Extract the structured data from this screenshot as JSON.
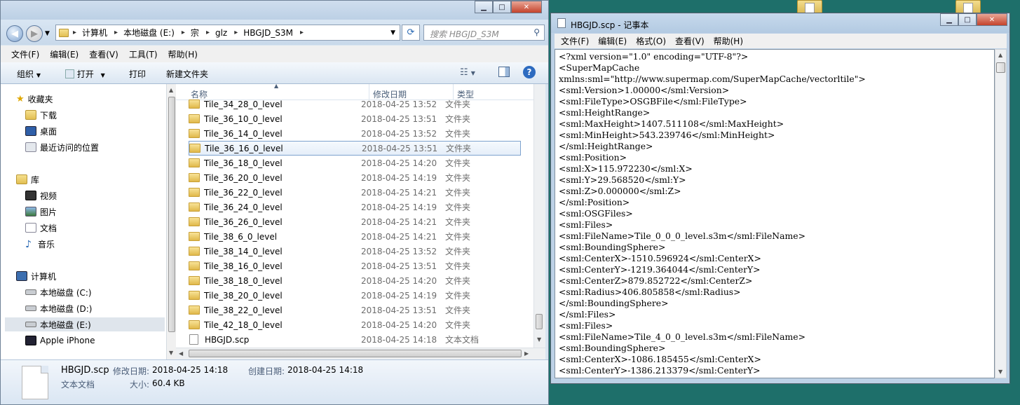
{
  "explorer": {
    "address": {
      "crumbs": [
        "计算机",
        "本地磁盘 (E:)",
        "宗",
        "glz",
        "HBGJD_S3M"
      ]
    },
    "search": {
      "placeholder": "搜索 HBGJD_S3M"
    },
    "menu": [
      "文件(F)",
      "编辑(E)",
      "查看(V)",
      "工具(T)",
      "帮助(H)"
    ],
    "toolbar": {
      "organize": "组织",
      "open": "打开",
      "print": "打印",
      "new_folder": "新建文件夹"
    },
    "nav": {
      "favorites": "收藏夹",
      "downloads": "下载",
      "desktop": "桌面",
      "recent": "最近访问的位置",
      "libraries": "库",
      "videos": "视频",
      "pictures": "图片",
      "documents": "文档",
      "music": "音乐",
      "computer": "计算机",
      "drive_c": "本地磁盘 (C:)",
      "drive_d": "本地磁盘 (D:)",
      "drive_e": "本地磁盘 (E:)",
      "iphone": "Apple iPhone"
    },
    "columns": {
      "name": "名称",
      "date": "修改日期",
      "type": "类型"
    },
    "files": [
      {
        "name": "Tile_34_28_0_level",
        "date": "2018-04-25 13:52",
        "type": "文件夹"
      },
      {
        "name": "Tile_36_10_0_level",
        "date": "2018-04-25 13:51",
        "type": "文件夹"
      },
      {
        "name": "Tile_36_14_0_level",
        "date": "2018-04-25 13:52",
        "type": "文件夹"
      },
      {
        "name": "Tile_36_16_0_level",
        "date": "2018-04-25 13:51",
        "type": "文件夹"
      },
      {
        "name": "Tile_36_18_0_level",
        "date": "2018-04-25 14:20",
        "type": "文件夹"
      },
      {
        "name": "Tile_36_20_0_level",
        "date": "2018-04-25 14:19",
        "type": "文件夹"
      },
      {
        "name": "Tile_36_22_0_level",
        "date": "2018-04-25 14:21",
        "type": "文件夹"
      },
      {
        "name": "Tile_36_24_0_level",
        "date": "2018-04-25 14:19",
        "type": "文件夹"
      },
      {
        "name": "Tile_36_26_0_level",
        "date": "2018-04-25 14:21",
        "type": "文件夹"
      },
      {
        "name": "Tile_38_6_0_level",
        "date": "2018-04-25 14:21",
        "type": "文件夹"
      },
      {
        "name": "Tile_38_14_0_level",
        "date": "2018-04-25 13:52",
        "type": "文件夹"
      },
      {
        "name": "Tile_38_16_0_level",
        "date": "2018-04-25 13:51",
        "type": "文件夹"
      },
      {
        "name": "Tile_38_18_0_level",
        "date": "2018-04-25 14:20",
        "type": "文件夹"
      },
      {
        "name": "Tile_38_20_0_level",
        "date": "2018-04-25 14:19",
        "type": "文件夹"
      },
      {
        "name": "Tile_38_22_0_level",
        "date": "2018-04-25 13:51",
        "type": "文件夹"
      },
      {
        "name": "Tile_42_18_0_level",
        "date": "2018-04-25 14:20",
        "type": "文件夹"
      },
      {
        "name": "HBGJD.scp",
        "date": "2018-04-25 14:18",
        "type": "文本文档"
      }
    ],
    "details": {
      "name": "HBGJD.scp",
      "modified_label": "修改日期:",
      "modified": "2018-04-25 14:18",
      "created_label": "创建日期:",
      "created": "2018-04-25 14:18",
      "type": "文本文档",
      "size_label": "大小:",
      "size": "60.4 KB"
    }
  },
  "notepad": {
    "title": "HBGJD.scp - 记事本",
    "menu": [
      "文件(F)",
      "编辑(E)",
      "格式(O)",
      "查看(V)",
      "帮助(H)"
    ],
    "lines": [
      "<?xml version=\"1.0\" encoding=\"UTF-8\"?>",
      "<SuperMapCache",
      "xmlns:sml=\"http://www.supermap.com/SuperMapCache/vectorltile\">",
      "<sml:Version>1.00000</sml:Version>",
      "<sml:FileType>OSGBFile</sml:FileType>",
      "<sml:HeightRange>",
      "<sml:MaxHeight>1407.511108</sml:MaxHeight>",
      "<sml:MinHeight>543.239746</sml:MinHeight>",
      "</sml:HeightRange>",
      "<sml:Position>",
      "<sml:X>115.972230</sml:X>",
      "<sml:Y>29.568520</sml:Y>",
      "<sml:Z>0.000000</sml:Z>",
      "</sml:Position>",
      "<sml:OSGFiles>",
      "<sml:Files>",
      "<sml:FileName>Tile_0_0_0_level.s3m</sml:FileName>",
      "<sml:BoundingSphere>",
      "<sml:CenterX>-1510.596924</sml:CenterX>",
      "<sml:CenterY>-1219.364044</sml:CenterY>",
      "<sml:CenterZ>879.852722</sml:CenterZ>",
      "<sml:Radius>406.805858</sml:Radius>",
      "</sml:BoundingSphere>",
      "</sml:Files>",
      "<sml:Files>",
      "<sml:FileName>Tile_4_0_0_level.s3m</sml:FileName>",
      "<sml:BoundingSphere>",
      "<sml:CenterX>-1086.185455</sml:CenterX>",
      "<sml:CenterY>-1386.213379</sml:CenterY>"
    ]
  }
}
